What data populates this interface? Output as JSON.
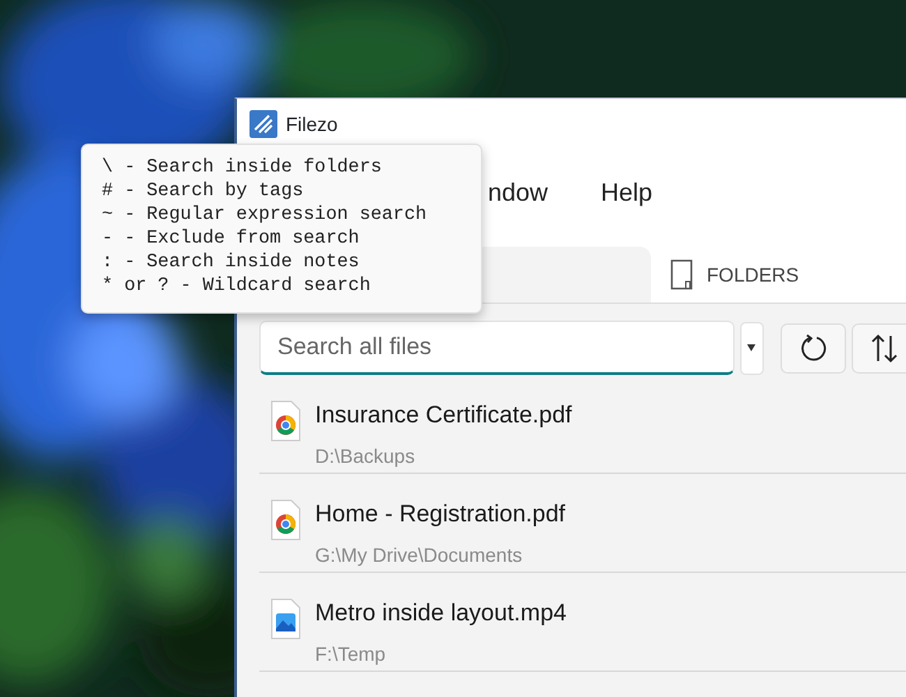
{
  "window": {
    "title": "Filezo"
  },
  "menu": [
    "ndow",
    "Help"
  ],
  "tabs": [
    {
      "selected": true
    },
    {
      "label": "FOLDERS",
      "selected": false
    }
  ],
  "search": {
    "placeholder": "Search all files"
  },
  "files": [
    {
      "kind": "pdf",
      "name": "Insurance Certificate.pdf",
      "path": "D:\\Backups"
    },
    {
      "kind": "pdf",
      "name": "Home - Registration.pdf",
      "path": "G:\\My Drive\\Documents"
    },
    {
      "kind": "video",
      "name": "Metro inside layout.mp4",
      "path": "F:\\Temp"
    }
  ],
  "tooltip": [
    "\\ - Search inside folders",
    "# - Search by tags",
    "~ - Regular expression search",
    "- - Exclude from search",
    ": - Search inside notes",
    "* or ? - Wildcard search"
  ]
}
